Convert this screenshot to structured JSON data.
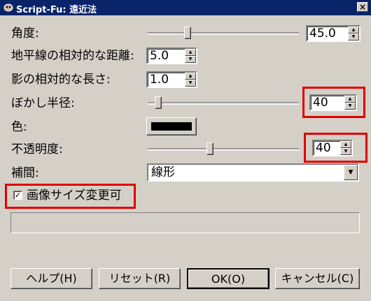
{
  "window": {
    "title": "Script-Fu: 遠近法",
    "close_label": "×"
  },
  "fields": {
    "angle": {
      "label": "角度:",
      "value": "45.0"
    },
    "horizon": {
      "label": "地平線の相対的な距離:",
      "value": "5.0"
    },
    "shadow_length": {
      "label": "影の相対的な長さ:",
      "value": "1.0"
    },
    "blur_radius": {
      "label": "ぼかし半径:",
      "value": "40"
    },
    "color": {
      "label": "色:",
      "value": "#000000"
    },
    "opacity": {
      "label": "不透明度:",
      "value": "40"
    },
    "interpolation": {
      "label": "補間:",
      "value": "線形"
    },
    "resize": {
      "label": "画像サイズ変更可",
      "checked": true,
      "check_glyph": "✓"
    }
  },
  "buttons": {
    "help": "ヘルプ(H)",
    "reset": "リセット(R)",
    "ok": "OK(O)",
    "cancel": "キャンセル(C)"
  },
  "highlight_color": "#e00000"
}
